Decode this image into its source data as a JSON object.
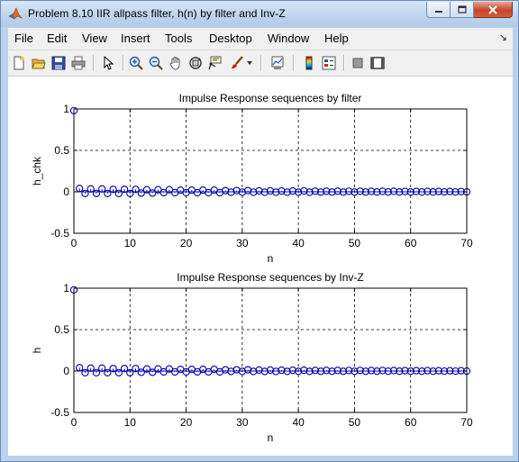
{
  "window": {
    "title": "Problem 8.10 IIR allpass filter, h(n) by filter and Inv-Z",
    "controls": {
      "minimize": "minimize-icon",
      "maximize": "maximize-icon",
      "close": "close-icon"
    }
  },
  "menubar": {
    "items": [
      "File",
      "Edit",
      "View",
      "Insert",
      "Tools",
      "Desktop",
      "Window",
      "Help"
    ]
  },
  "toolbar": {
    "icons": [
      "new-figure-icon",
      "open-file-icon",
      "save-icon",
      "print-icon",
      "pointer-icon",
      "zoom-in-icon",
      "zoom-out-icon",
      "pan-hand-icon",
      "rotate-3d-icon",
      "data-cursor-icon",
      "brush-icon",
      "link-plot-icon",
      "colorbar-icon",
      "legend-icon",
      "hide-plot-tools-icon",
      "show-plot-tools-icon"
    ]
  },
  "colors": {
    "stem": "#0000a8",
    "grid": "#000000",
    "axes": "#000000"
  },
  "chart_data": [
    {
      "type": "stem",
      "title": "Impulse Response sequences by filter",
      "xlabel": "n",
      "ylabel": "h_chk",
      "xlim": [
        0,
        70
      ],
      "ylim": [
        -0.5,
        1
      ],
      "xticks": [
        "0",
        "10",
        "20",
        "30",
        "40",
        "50",
        "60",
        "70"
      ],
      "yticks": [
        "-0.5",
        "0",
        "0.5",
        "1"
      ],
      "grid": true,
      "series": [
        {
          "x": [
            0,
            1,
            2,
            3,
            4,
            5,
            6,
            7,
            8,
            9,
            10,
            11,
            12,
            13,
            14,
            15,
            16,
            17,
            18,
            19,
            20,
            21,
            22,
            23,
            24,
            25,
            26,
            27,
            28,
            29,
            30,
            31,
            32,
            33,
            34,
            35,
            36,
            37,
            38,
            39,
            40,
            41,
            42,
            43,
            44,
            45,
            46,
            47,
            48,
            49,
            50,
            51,
            52,
            53,
            54,
            55,
            56,
            57,
            58,
            59,
            60,
            61,
            62,
            63,
            64,
            65,
            66,
            67,
            68,
            69,
            70
          ],
          "values": [
            0.98,
            0.04,
            -0.02,
            0.035,
            -0.02,
            0.035,
            -0.02,
            0.03,
            -0.02,
            0.03,
            -0.02,
            0.03,
            -0.015,
            0.025,
            -0.015,
            0.025,
            -0.01,
            0.025,
            -0.01,
            0.02,
            -0.01,
            0.02,
            -0.01,
            0.02,
            -0.01,
            0.02,
            -0.01,
            0.015,
            -0.005,
            0.015,
            -0.005,
            0.015,
            -0.005,
            0.012,
            -0.005,
            0.012,
            -0.005,
            0.01,
            -0.004,
            0.01,
            -0.004,
            0.01,
            -0.004,
            0.008,
            -0.003,
            0.008,
            -0.003,
            0.008,
            -0.003,
            0.007,
            -0.003,
            0.007,
            -0.003,
            0.006,
            -0.002,
            0.006,
            -0.002,
            0.006,
            -0.002,
            0.005,
            -0.002,
            0.005,
            -0.002,
            0.005,
            -0.002,
            0.004,
            -0.001,
            0.004,
            -0.001,
            0.004,
            -0.001
          ]
        }
      ]
    },
    {
      "type": "stem",
      "title": "Impulse Response sequences by Inv-Z",
      "xlabel": "n",
      "ylabel": "h",
      "xlim": [
        0,
        70
      ],
      "ylim": [
        -0.5,
        1
      ],
      "xticks": [
        "0",
        "10",
        "20",
        "30",
        "40",
        "50",
        "60",
        "70"
      ],
      "yticks": [
        "-0.5",
        "0",
        "0.5",
        "1"
      ],
      "grid": true,
      "series": [
        {
          "x": [
            0,
            1,
            2,
            3,
            4,
            5,
            6,
            7,
            8,
            9,
            10,
            11,
            12,
            13,
            14,
            15,
            16,
            17,
            18,
            19,
            20,
            21,
            22,
            23,
            24,
            25,
            26,
            27,
            28,
            29,
            30,
            31,
            32,
            33,
            34,
            35,
            36,
            37,
            38,
            39,
            40,
            41,
            42,
            43,
            44,
            45,
            46,
            47,
            48,
            49,
            50,
            51,
            52,
            53,
            54,
            55,
            56,
            57,
            58,
            59,
            60,
            61,
            62,
            63,
            64,
            65,
            66,
            67,
            68,
            69,
            70
          ],
          "values": [
            0.98,
            0.04,
            -0.02,
            0.035,
            -0.02,
            0.035,
            -0.02,
            0.03,
            -0.02,
            0.03,
            -0.02,
            0.03,
            -0.015,
            0.025,
            -0.015,
            0.025,
            -0.01,
            0.025,
            -0.01,
            0.02,
            -0.01,
            0.02,
            -0.01,
            0.02,
            -0.01,
            0.02,
            -0.01,
            0.015,
            -0.005,
            0.015,
            -0.005,
            0.015,
            -0.005,
            0.012,
            -0.005,
            0.012,
            -0.005,
            0.01,
            -0.004,
            0.01,
            -0.004,
            0.01,
            -0.004,
            0.008,
            -0.003,
            0.008,
            -0.003,
            0.008,
            -0.003,
            0.007,
            -0.003,
            0.007,
            -0.003,
            0.006,
            -0.002,
            0.006,
            -0.002,
            0.006,
            -0.002,
            0.005,
            -0.002,
            0.005,
            -0.002,
            0.005,
            -0.002,
            0.004,
            -0.001,
            0.004,
            -0.001,
            0.004,
            -0.001
          ]
        }
      ]
    }
  ]
}
